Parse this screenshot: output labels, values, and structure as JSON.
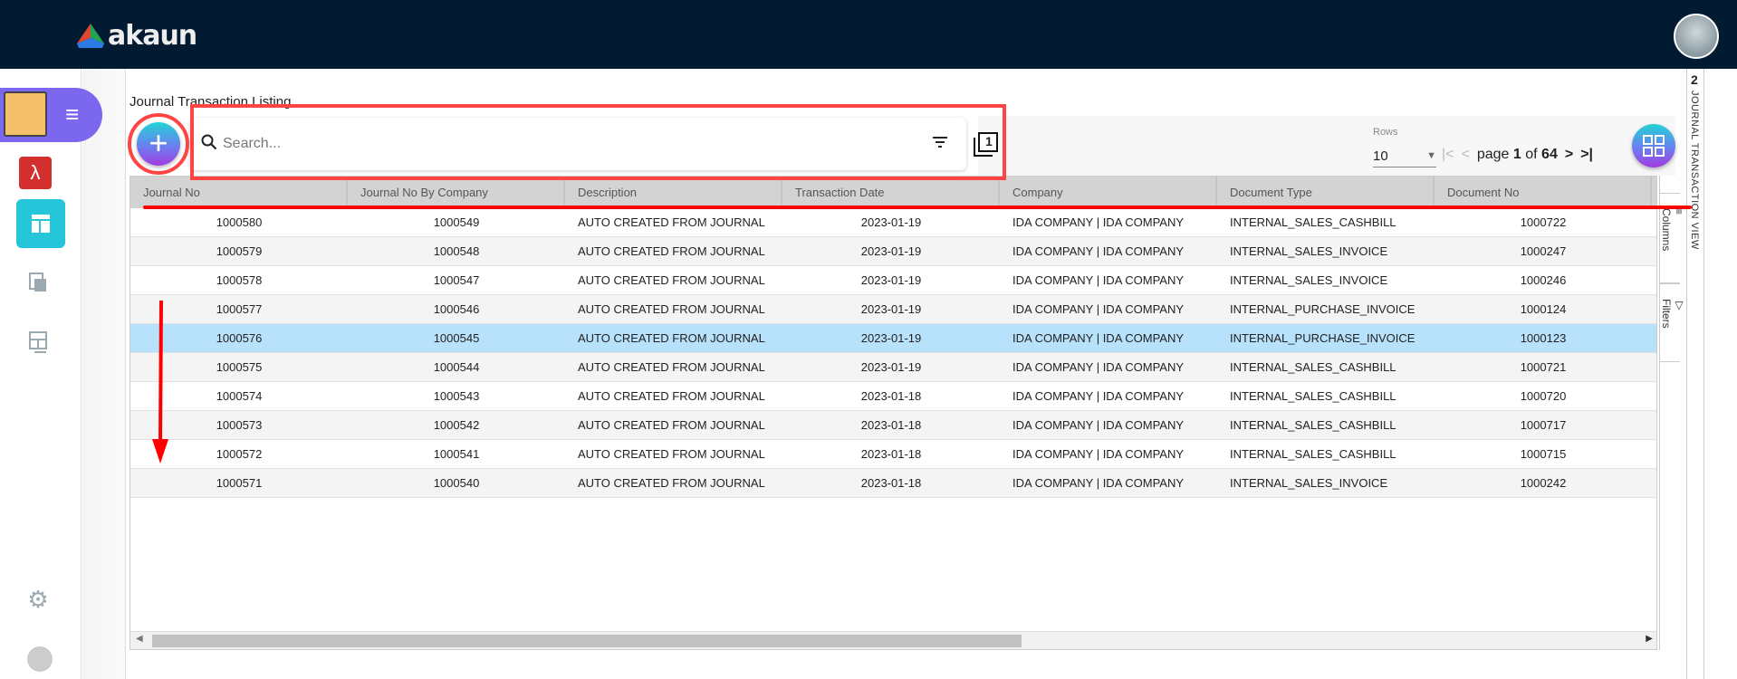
{
  "app": {
    "name": "akaun"
  },
  "page": {
    "title": "Journal Transaction Listing"
  },
  "search": {
    "placeholder": "Search...",
    "value": ""
  },
  "toolbar": {
    "stack_badge": "1"
  },
  "pagination": {
    "rows_label": "Rows",
    "rows_value": "10",
    "page_word": "page",
    "current_page": "1",
    "of_word": "of",
    "total_pages": "64"
  },
  "table": {
    "columns": [
      "Journal No",
      "Journal No By Company",
      "Description",
      "Transaction Date",
      "Company",
      "Document Type",
      "Document No"
    ],
    "rows": [
      [
        "1000580",
        "1000549",
        "AUTO CREATED FROM JOURNAL",
        "2023-01-19",
        "IDA COMPANY | IDA COMPANY",
        "INTERNAL_SALES_CASHBILL",
        "1000722"
      ],
      [
        "1000579",
        "1000548",
        "AUTO CREATED FROM JOURNAL",
        "2023-01-19",
        "IDA COMPANY | IDA COMPANY",
        "INTERNAL_SALES_INVOICE",
        "1000247"
      ],
      [
        "1000578",
        "1000547",
        "AUTO CREATED FROM JOURNAL",
        "2023-01-19",
        "IDA COMPANY | IDA COMPANY",
        "INTERNAL_SALES_INVOICE",
        "1000246"
      ],
      [
        "1000577",
        "1000546",
        "AUTO CREATED FROM JOURNAL",
        "2023-01-19",
        "IDA COMPANY | IDA COMPANY",
        "INTERNAL_PURCHASE_INVOICE",
        "1000124"
      ],
      [
        "1000576",
        "1000545",
        "AUTO CREATED FROM JOURNAL",
        "2023-01-19",
        "IDA COMPANY | IDA COMPANY",
        "INTERNAL_PURCHASE_INVOICE",
        "1000123"
      ],
      [
        "1000575",
        "1000544",
        "AUTO CREATED FROM JOURNAL",
        "2023-01-19",
        "IDA COMPANY | IDA COMPANY",
        "INTERNAL_SALES_CASHBILL",
        "1000721"
      ],
      [
        "1000574",
        "1000543",
        "AUTO CREATED FROM JOURNAL",
        "2023-01-18",
        "IDA COMPANY | IDA COMPANY",
        "INTERNAL_SALES_CASHBILL",
        "1000720"
      ],
      [
        "1000573",
        "1000542",
        "AUTO CREATED FROM JOURNAL",
        "2023-01-18",
        "IDA COMPANY | IDA COMPANY",
        "INTERNAL_SALES_CASHBILL",
        "1000717"
      ],
      [
        "1000572",
        "1000541",
        "AUTO CREATED FROM JOURNAL",
        "2023-01-18",
        "IDA COMPANY | IDA COMPANY",
        "INTERNAL_SALES_CASHBILL",
        "1000715"
      ],
      [
        "1000571",
        "1000540",
        "AUTO CREATED FROM JOURNAL",
        "2023-01-18",
        "IDA COMPANY | IDA COMPANY",
        "INTERNAL_SALES_INVOICE",
        "1000242"
      ]
    ],
    "selected_row": 4
  },
  "side_panel": {
    "columns_label": "Columns",
    "filters_label": "Filters"
  },
  "right_panel": {
    "count": "2",
    "label": "JOURNAL TRANSACTION VIEW"
  },
  "colors": {
    "header_bg": "#021b33",
    "accent_purple": "#7b68ee",
    "active_teal": "#26c6da",
    "selected_row": "#b8e2fb",
    "annotation_red": "#ff0000"
  }
}
